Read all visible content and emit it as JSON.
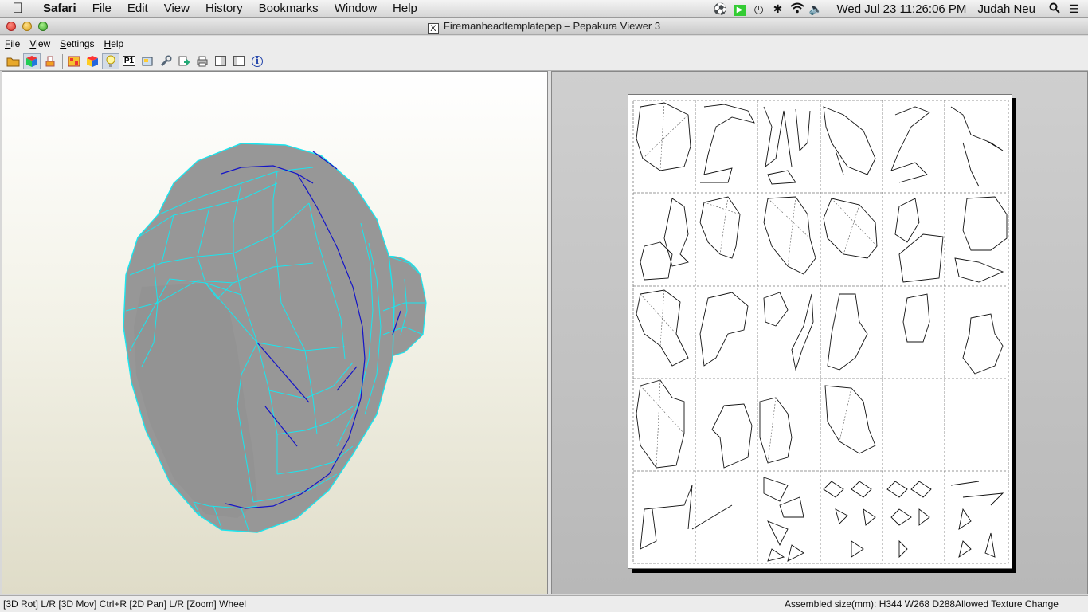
{
  "menubar": {
    "app_name": "Safari",
    "items": [
      "File",
      "Edit",
      "View",
      "History",
      "Bookmarks",
      "Window",
      "Help"
    ],
    "clock": "Wed Jul 23  11:26:06 PM",
    "user": "Judah Neu"
  },
  "window": {
    "title": "Firemanheadtemplatepep – Pepakura Viewer 3",
    "menu": [
      "File",
      "View",
      "Settings",
      "Help"
    ]
  },
  "toolbar": {
    "icons": [
      "open-folder-icon",
      "3d-view-icon",
      "print-icon",
      "2d-view-icon",
      "color-cube-icon",
      "light-bulb-icon",
      "page-number-icon",
      "layout-icon",
      "wrench-icon",
      "export-icon",
      "printer-icon",
      "single-page-icon",
      "two-page-icon",
      "info-icon"
    ],
    "p1_label": "P1",
    "info_label": "i"
  },
  "status": {
    "left": "[3D Rot] L/R [3D Mov] Ctrl+R [2D Pan] L/R [Zoom] Wheel",
    "right": "Assembled size(mm): H344 W268 D288Allowed Texture Change"
  },
  "colors": {
    "mesh_fill": "#979797",
    "mesh_edge": "#19e6ef",
    "mesh_seam": "#1414c8",
    "accent": "#2a74d9"
  }
}
